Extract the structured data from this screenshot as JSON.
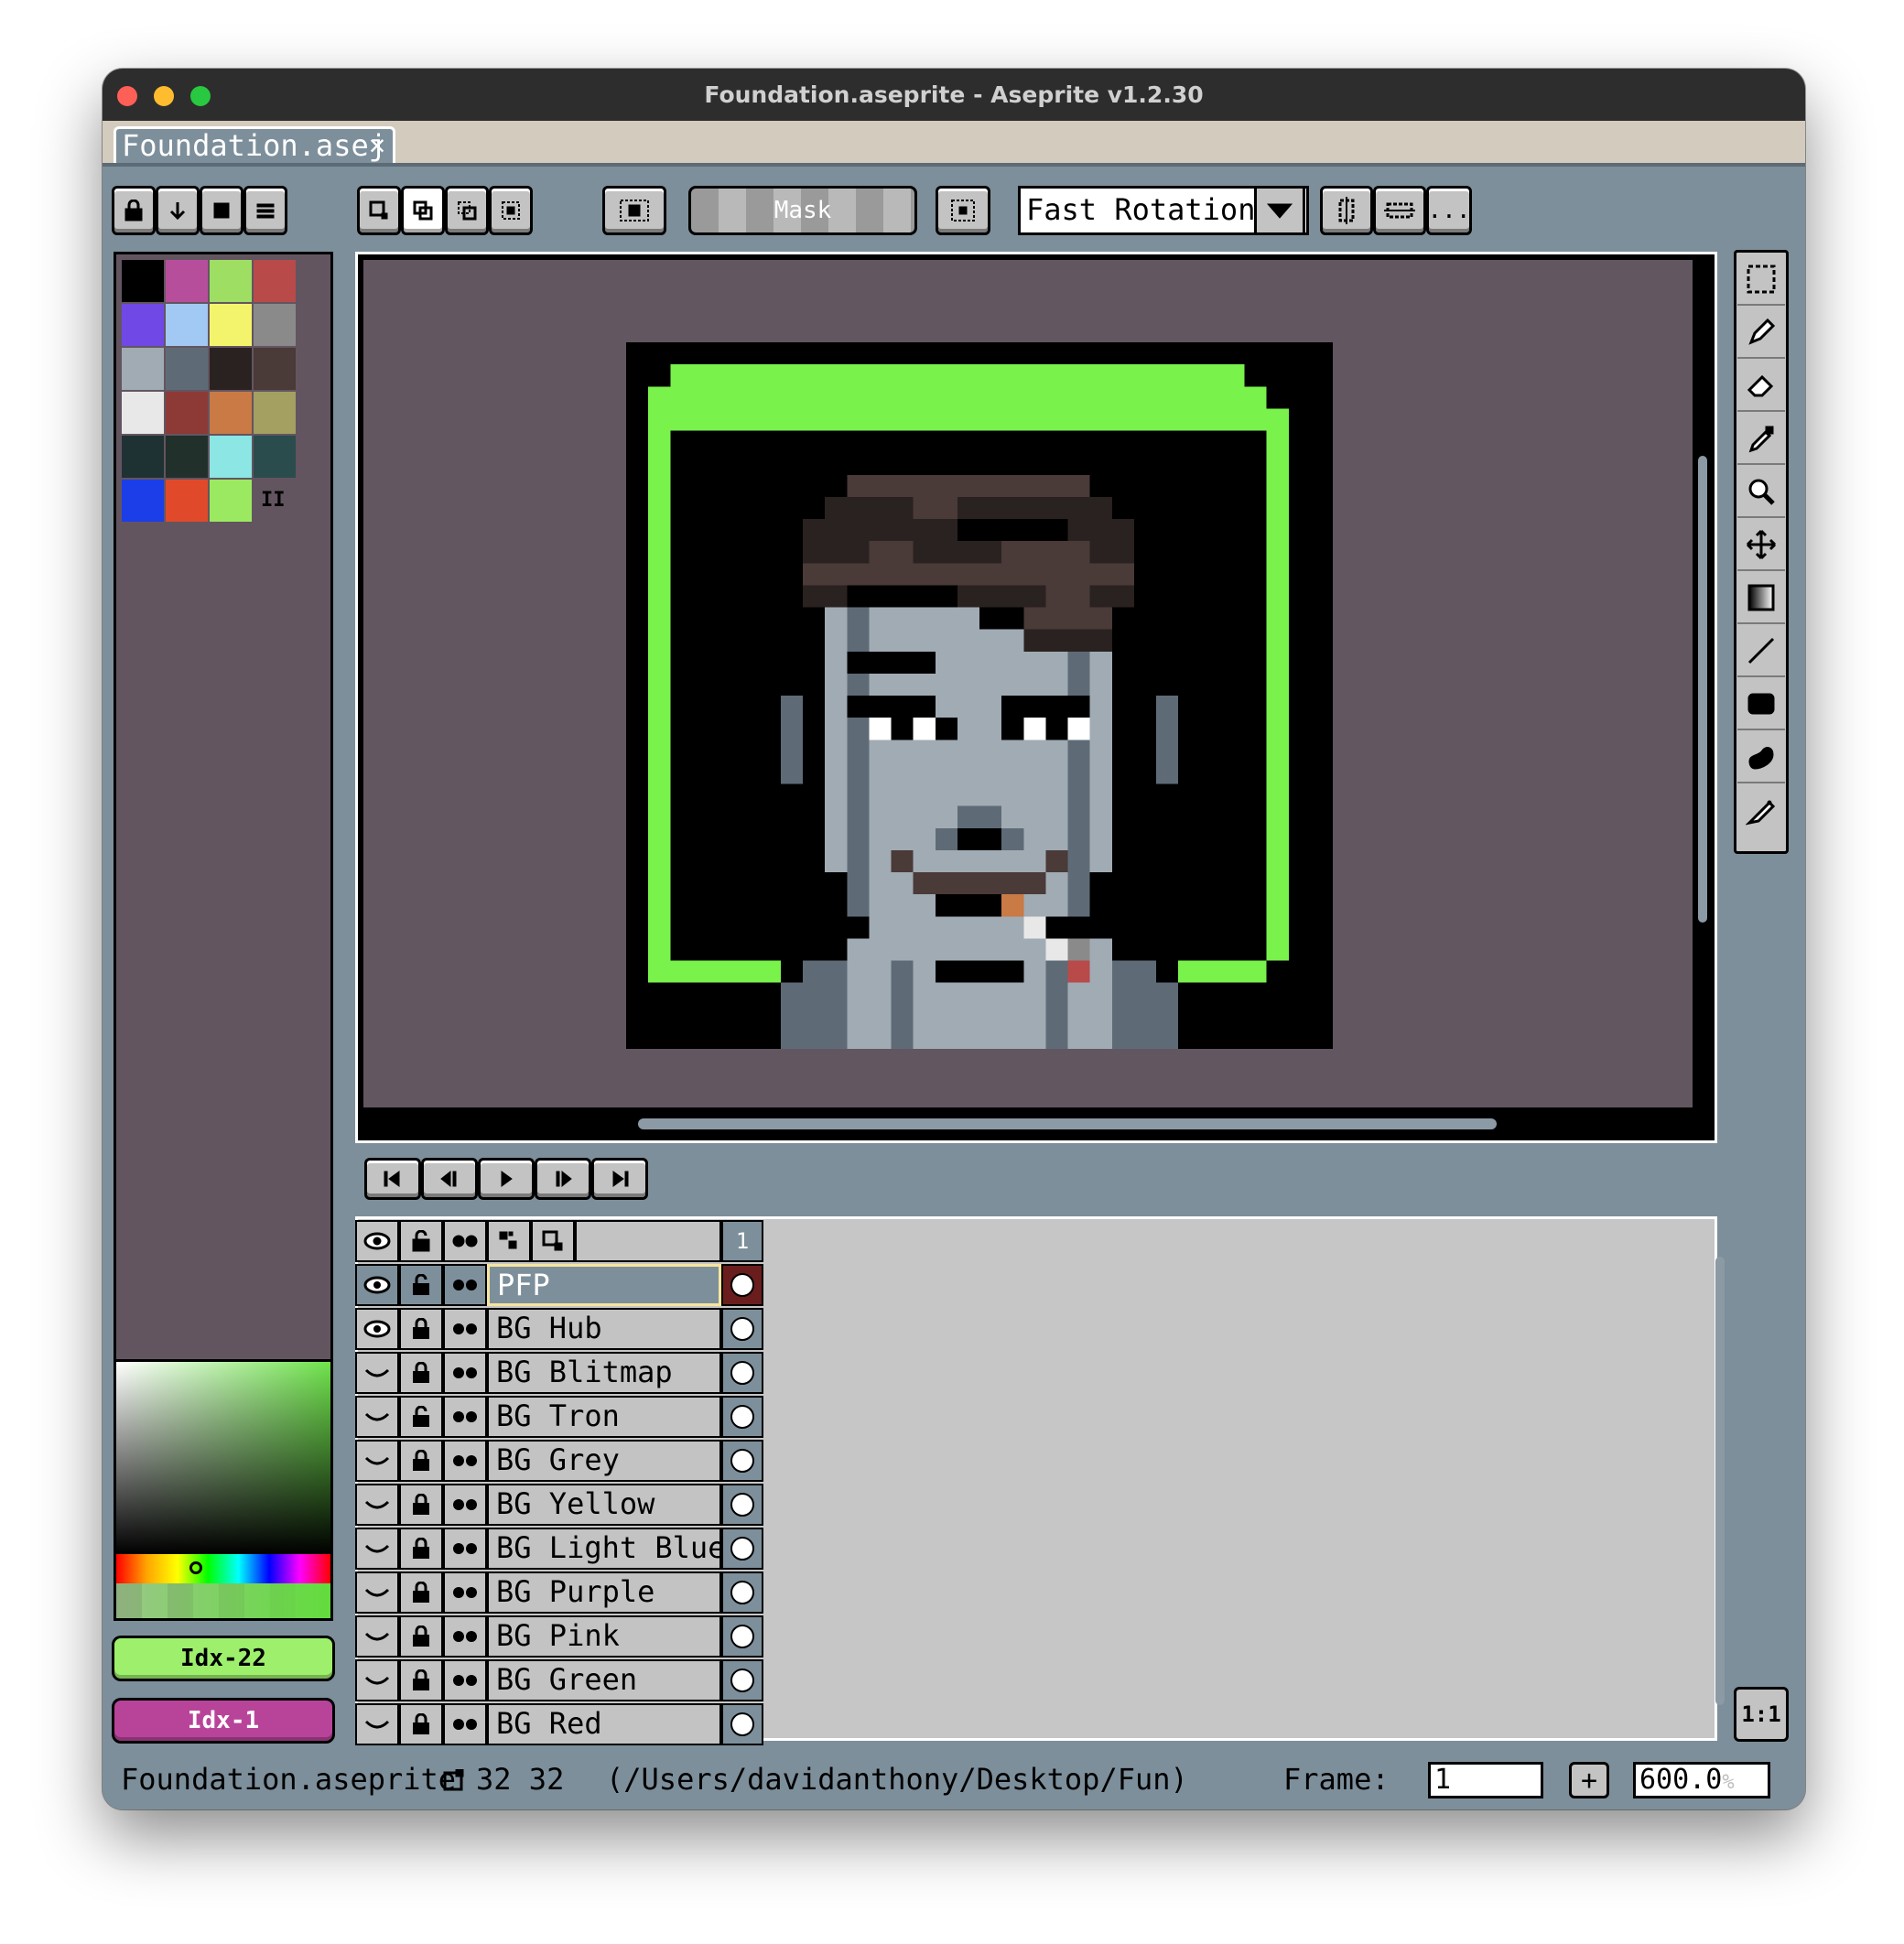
{
  "window": {
    "title": "Foundation.aseprite - Aseprite v1.2.30"
  },
  "tab": {
    "label": "Foundation.asej",
    "close": "✕"
  },
  "toolbar": {
    "mask_label": "Mask",
    "rotation_value": "Fast Rotation",
    "more_label": "..."
  },
  "palette": {
    "swatches": [
      "#000000",
      "#b74e9c",
      "#9ede63",
      "#b84a4a",
      "#7048e6",
      "#a2c8f4",
      "#f4f46c",
      "#8a8a8a",
      "#a1abb4",
      "#5e6b76",
      "#2a2220",
      "#4a3a38",
      "#e8e8e8",
      "#8d3a36",
      "#c97a45",
      "#a3a061",
      "#1e3234",
      "#21302b",
      "#8be6e4",
      "#2a4c4d",
      "#1b3ee8",
      "#e04a2a",
      "#9be960"
    ],
    "options_icon": "II"
  },
  "colors": {
    "foreground": {
      "label": "Idx-22",
      "color": "#9ef06c"
    },
    "background": {
      "label": "Idx-1",
      "color": "#b8449a"
    },
    "frame_accent": "#79f24c"
  },
  "timeline": {
    "frame_header": "1",
    "layers": [
      {
        "name": "PFP",
        "visible": true,
        "locked": false,
        "selected": true
      },
      {
        "name": "BG Hub",
        "visible": true,
        "locked": true
      },
      {
        "name": "BG Blitmap",
        "visible": false,
        "locked": true
      },
      {
        "name": "BG Tron",
        "visible": false,
        "locked": false
      },
      {
        "name": "BG Grey",
        "visible": false,
        "locked": true
      },
      {
        "name": "BG Yellow",
        "visible": false,
        "locked": true
      },
      {
        "name": "BG Light Blue",
        "visible": false,
        "locked": true
      },
      {
        "name": "BG Purple",
        "visible": false,
        "locked": true
      },
      {
        "name": "BG Pink",
        "visible": false,
        "locked": true
      },
      {
        "name": "BG Green",
        "visible": false,
        "locked": true
      },
      {
        "name": "BG Red",
        "visible": false,
        "locked": true
      }
    ]
  },
  "status": {
    "filename": "Foundation.aseprite",
    "size": "32 32",
    "path": "(/Users/davidanthony/Desktop/Fun)",
    "frame_label": "Frame:",
    "frame_value": "1",
    "plus": "+",
    "zoom_value": "600.0",
    "zoom_unit": "%"
  },
  "zoom_reset": "1:1"
}
